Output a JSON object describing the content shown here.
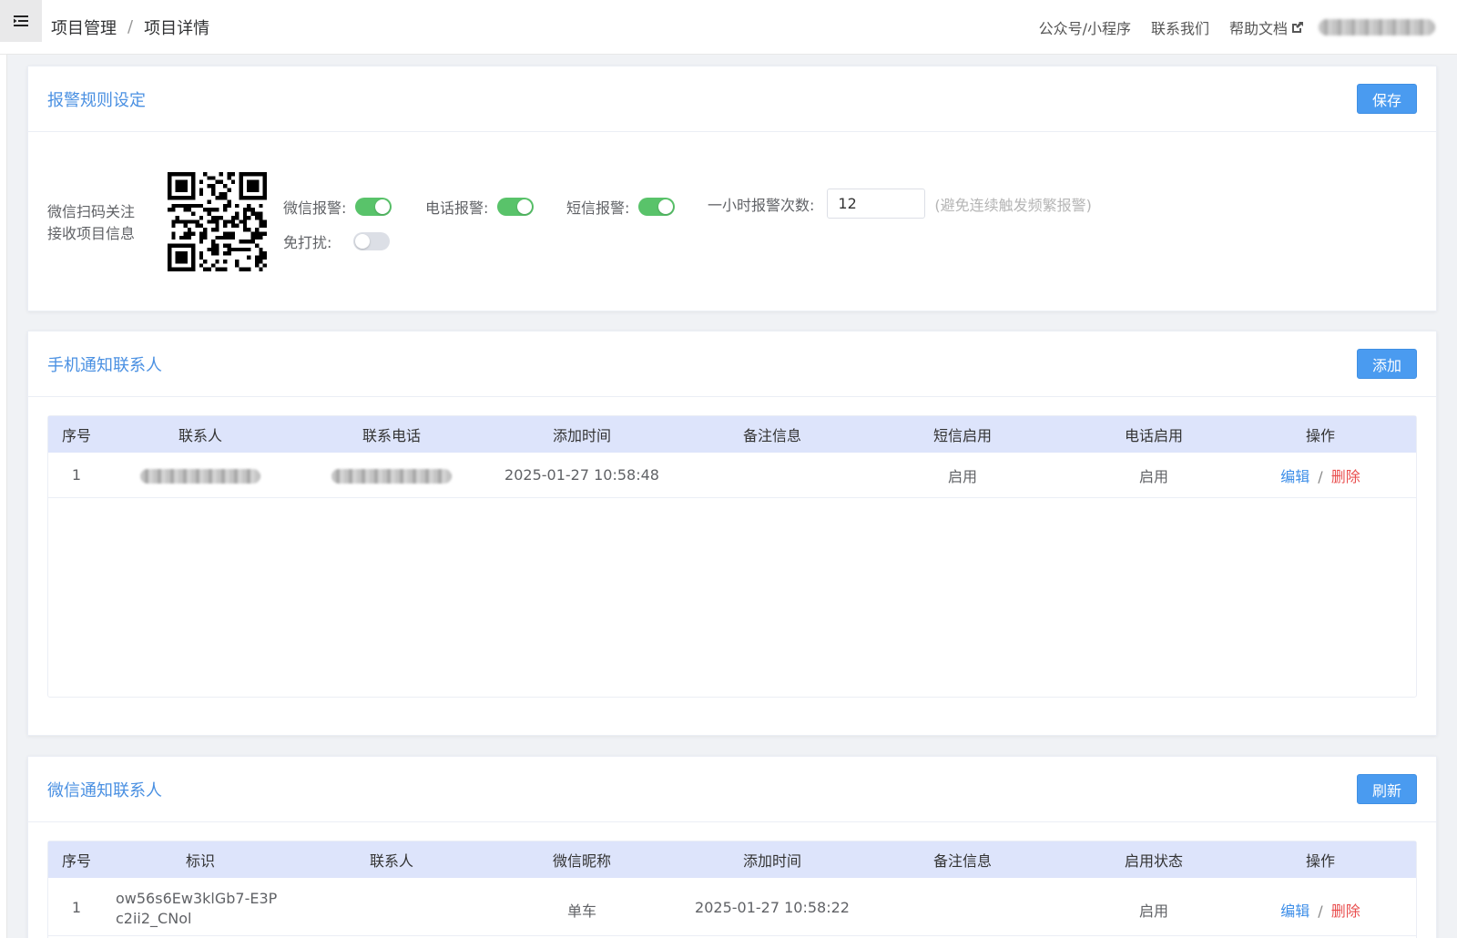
{
  "header": {
    "breadcrumb": [
      "项目管理",
      "项目详情"
    ],
    "breadcrumb_sep": "/",
    "links": [
      "公众号/小程序",
      "联系我们",
      "帮助文档"
    ]
  },
  "alarm": {
    "title": "报警规则设定",
    "save_label": "保存",
    "qr_caption_1": "微信扫码关注",
    "qr_caption_2": "接收项目信息",
    "wechat_label": "微信报警:",
    "wechat_on": true,
    "phone_label": "电话报警:",
    "phone_on": true,
    "sms_label": "短信报警:",
    "sms_on": true,
    "dnd_label": "免打扰:",
    "dnd_on": false,
    "hourly_label": "一小时报警次数:",
    "hourly_value": "12",
    "hourly_hint": "(避免连续触发频繁报警)"
  },
  "phone_contacts": {
    "title": "手机通知联系人",
    "add_label": "添加",
    "columns": [
      "序号",
      "联系人",
      "联系电话",
      "添加时间",
      "备注信息",
      "短信启用",
      "电话启用",
      "操作"
    ],
    "rows": [
      {
        "index": "1",
        "time": "2025-01-27 10:58:48",
        "note": "",
        "sms": "启用",
        "phone": "启用"
      }
    ],
    "edit_label": "编辑",
    "delete_label": "删除",
    "action_sep": "/"
  },
  "wechat_contacts": {
    "title": "微信通知联系人",
    "refresh_label": "刷新",
    "columns": [
      "序号",
      "标识",
      "联系人",
      "微信昵称",
      "添加时间",
      "备注信息",
      "启用状态",
      "操作"
    ],
    "rows": [
      {
        "index": "1",
        "id_line1": "ow56s6Ew3klGb7-E3P",
        "id_line2": "c2ii2_CNol",
        "contact": "",
        "nickname": "单车",
        "time": "2025-01-27 10:58:22",
        "note": "",
        "status": "启用"
      }
    ],
    "edit_label": "编辑",
    "delete_label": "删除",
    "action_sep": "/"
  },
  "colors": {
    "accent": "#4a90e2",
    "primary_button": "#4a9bf0",
    "switch_on": "#59c36a",
    "table_header": "#dde4fb",
    "delete": "#e94e4e"
  },
  "icons": [
    "menu-fold-icon",
    "external-link-icon",
    "qr-code"
  ]
}
